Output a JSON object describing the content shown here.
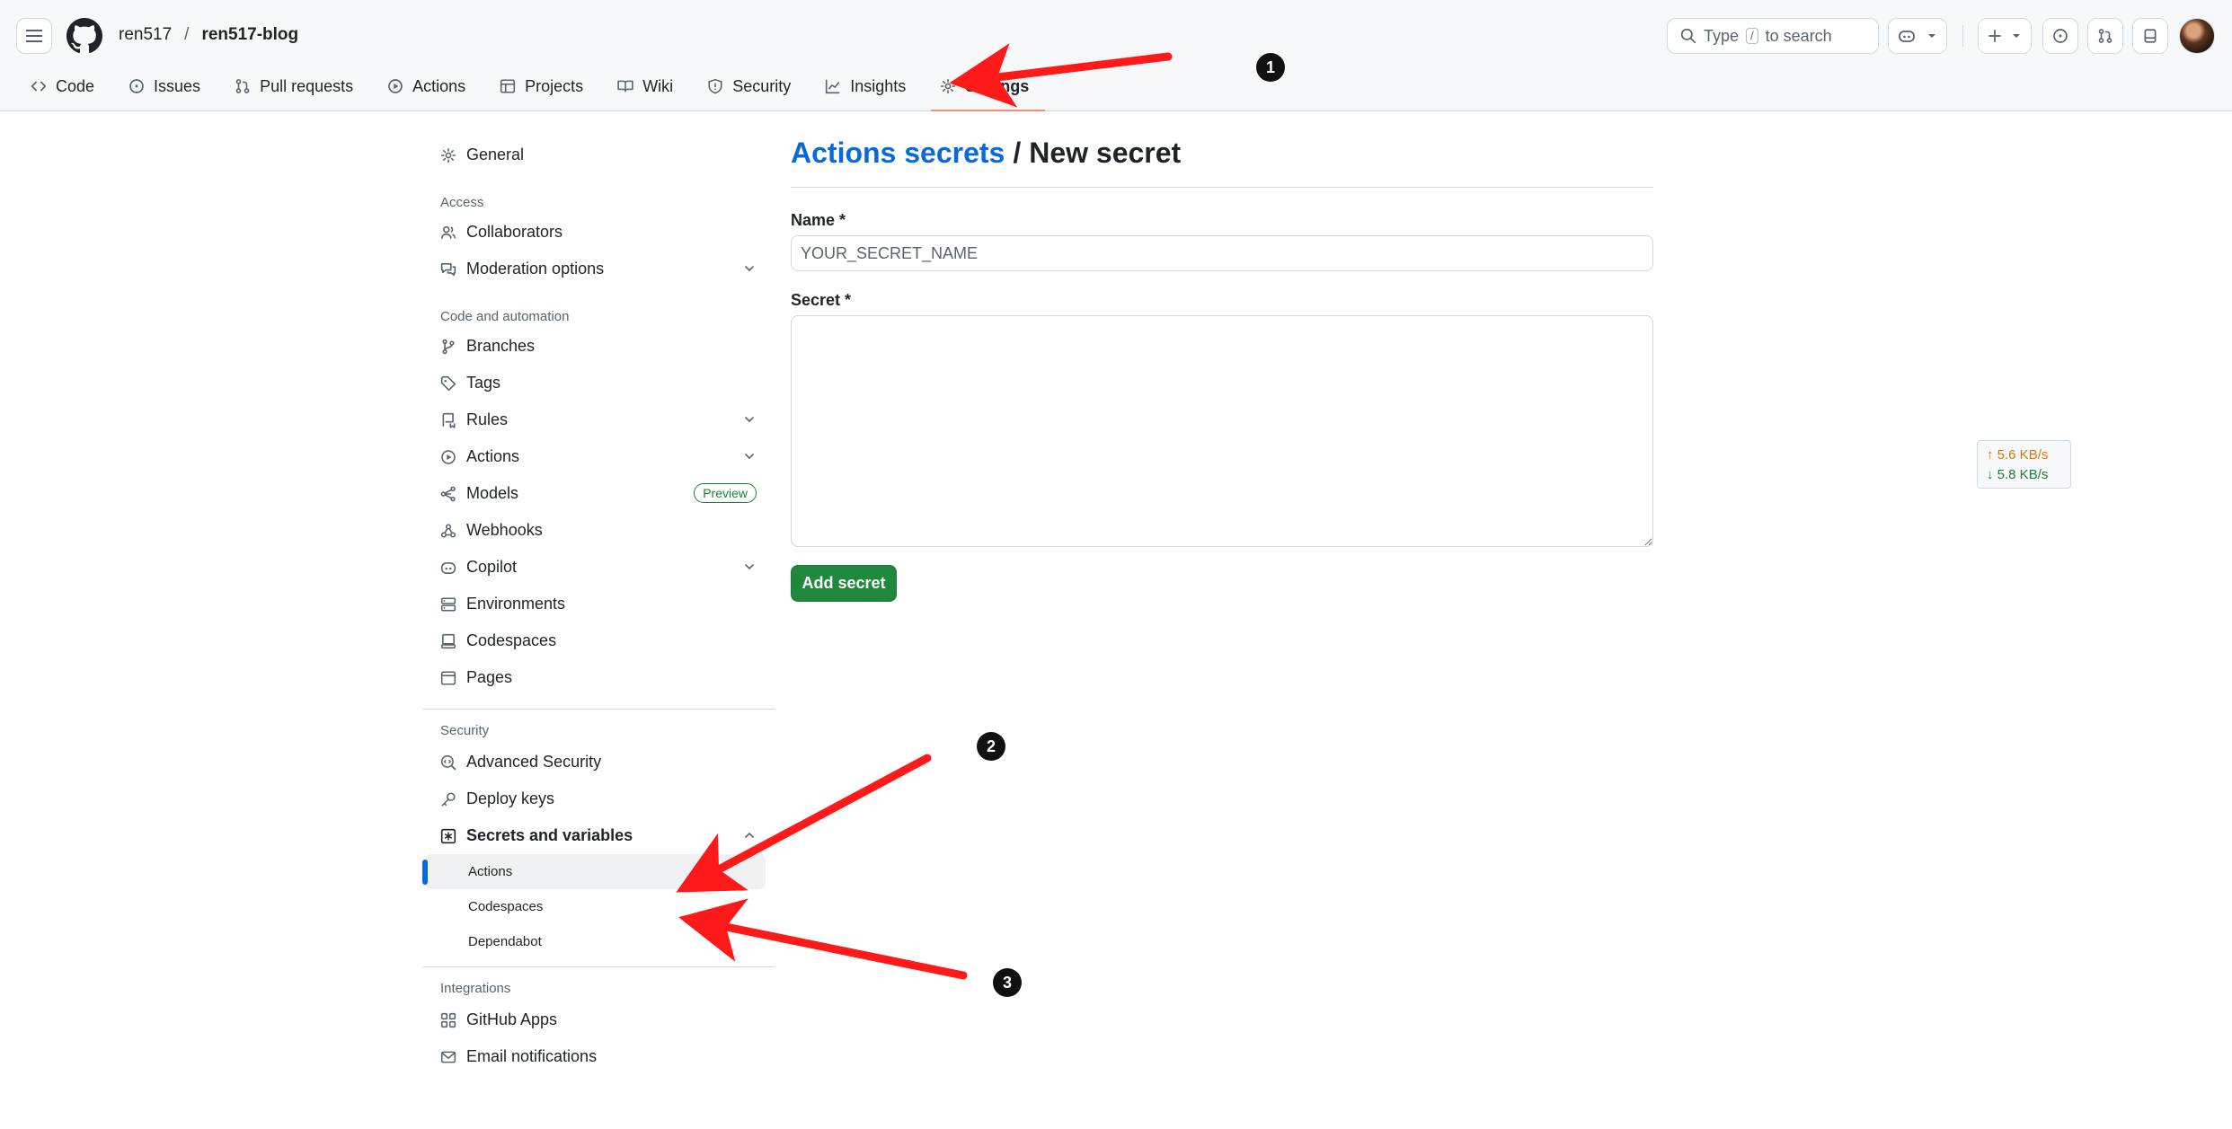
{
  "header": {
    "owner": "ren517",
    "separator": "/",
    "repo": "ren517-blog",
    "search_placeholder": "Type",
    "search_kbd": "/",
    "search_suffix": "to search"
  },
  "tabs": [
    {
      "label": "Code",
      "icon": "code-icon"
    },
    {
      "label": "Issues",
      "icon": "issue-icon"
    },
    {
      "label": "Pull requests",
      "icon": "pull-request-icon"
    },
    {
      "label": "Actions",
      "icon": "play-icon"
    },
    {
      "label": "Projects",
      "icon": "table-icon"
    },
    {
      "label": "Wiki",
      "icon": "book-icon"
    },
    {
      "label": "Security",
      "icon": "shield-icon"
    },
    {
      "label": "Insights",
      "icon": "graph-icon"
    },
    {
      "label": "Settings",
      "icon": "gear-icon",
      "active": true
    }
  ],
  "sidebar": {
    "general": "General",
    "access_heading": "Access",
    "collaborators": "Collaborators",
    "moderation": "Moderation options",
    "code_heading": "Code and automation",
    "branches": "Branches",
    "tags": "Tags",
    "rules": "Rules",
    "actions": "Actions",
    "models": "Models",
    "models_badge": "Preview",
    "webhooks": "Webhooks",
    "copilot": "Copilot",
    "environments": "Environments",
    "codespaces": "Codespaces",
    "pages": "Pages",
    "security_heading": "Security",
    "advanced_security": "Advanced Security",
    "deploy_keys": "Deploy keys",
    "secrets_vars": "Secrets and variables",
    "sub_actions": "Actions",
    "sub_codespaces": "Codespaces",
    "sub_dependabot": "Dependabot",
    "integrations_heading": "Integrations",
    "github_apps": "GitHub Apps",
    "email_notifications": "Email notifications"
  },
  "main": {
    "breadcrumb_link": "Actions secrets",
    "breadcrumb_sep": "/",
    "breadcrumb_current": "New secret",
    "name_label": "Name *",
    "name_placeholder": "YOUR_SECRET_NAME",
    "name_value": "",
    "secret_label": "Secret *",
    "secret_value": "",
    "add_button": "Add secret"
  },
  "network": {
    "up": "↑ 5.6 KB/s",
    "down": "↓ 5.8 KB/s"
  },
  "markers": [
    "1",
    "2",
    "3"
  ],
  "colors": {
    "link": "#0969da",
    "primary_button": "#1f883d",
    "annotation_arrow": "#ff1a1a",
    "active_tab_underline": "#fd8c73"
  }
}
